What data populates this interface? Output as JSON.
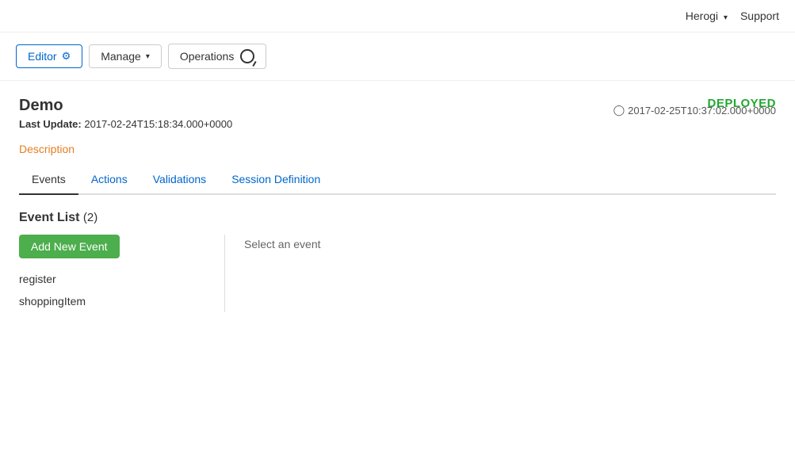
{
  "topNav": {
    "user": "Herogi",
    "support": "Support"
  },
  "toolbar": {
    "editorLabel": "Editor",
    "manageLabel": "Manage",
    "operationsLabel": "Operations"
  },
  "page": {
    "title": "Demo",
    "lastUpdateLabel": "Last Update:",
    "lastUpdateValue": "2017-02-24T15:18:34.000+0000",
    "status": "DEPLOYED",
    "timestamp": "2017-02-25T10:37:02.000+0000",
    "descriptionLabel": "Description"
  },
  "tabs": [
    {
      "label": "Events",
      "active": true
    },
    {
      "label": "Actions",
      "active": false
    },
    {
      "label": "Validations",
      "active": false
    },
    {
      "label": "Session Definition",
      "active": false
    }
  ],
  "eventList": {
    "title": "Event List",
    "count": "(2)",
    "addButtonLabel": "Add New Event",
    "selectPrompt": "Select an event",
    "items": [
      {
        "name": "register"
      },
      {
        "name": "shoppingItem"
      }
    ]
  }
}
